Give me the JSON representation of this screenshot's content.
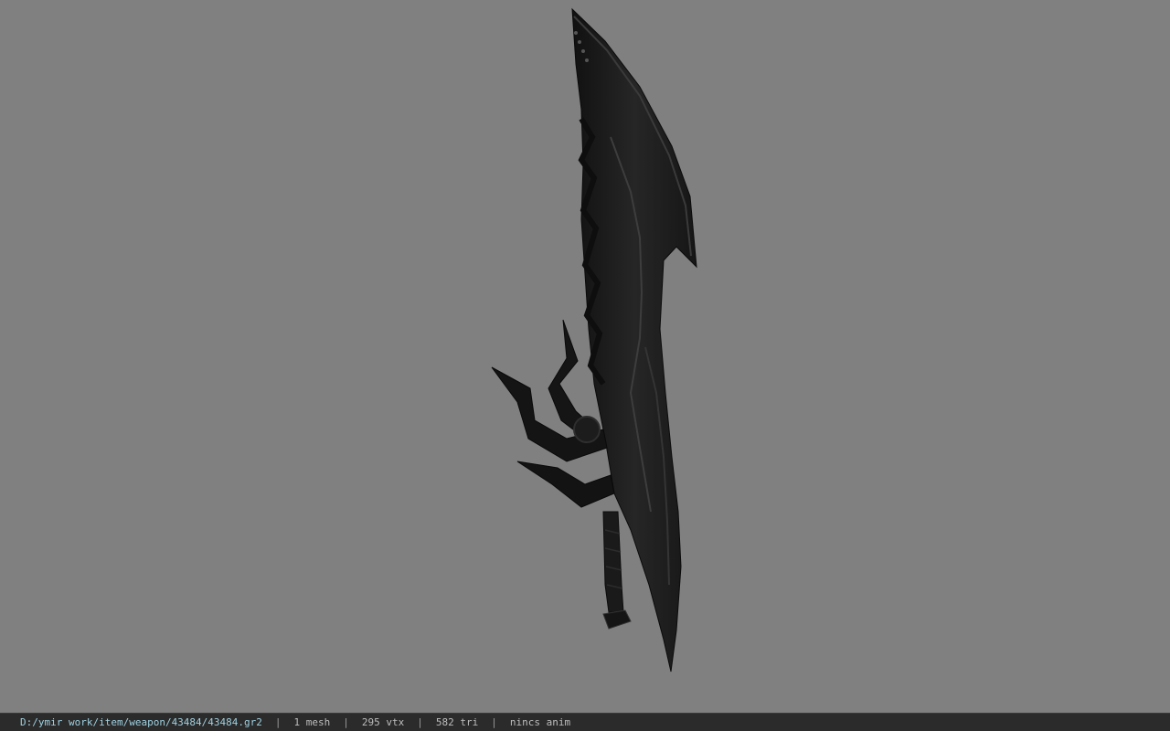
{
  "viewer": {
    "background_color": "#808080",
    "model_icon": "sword-model"
  },
  "status": {
    "file_path": "D:/ymir work/item/weapon/43484/43484.gr2",
    "separator": "|",
    "mesh": "1 mesh",
    "vtx": "295 vtx",
    "tri": "582 tri",
    "anim": "nincs anim"
  }
}
